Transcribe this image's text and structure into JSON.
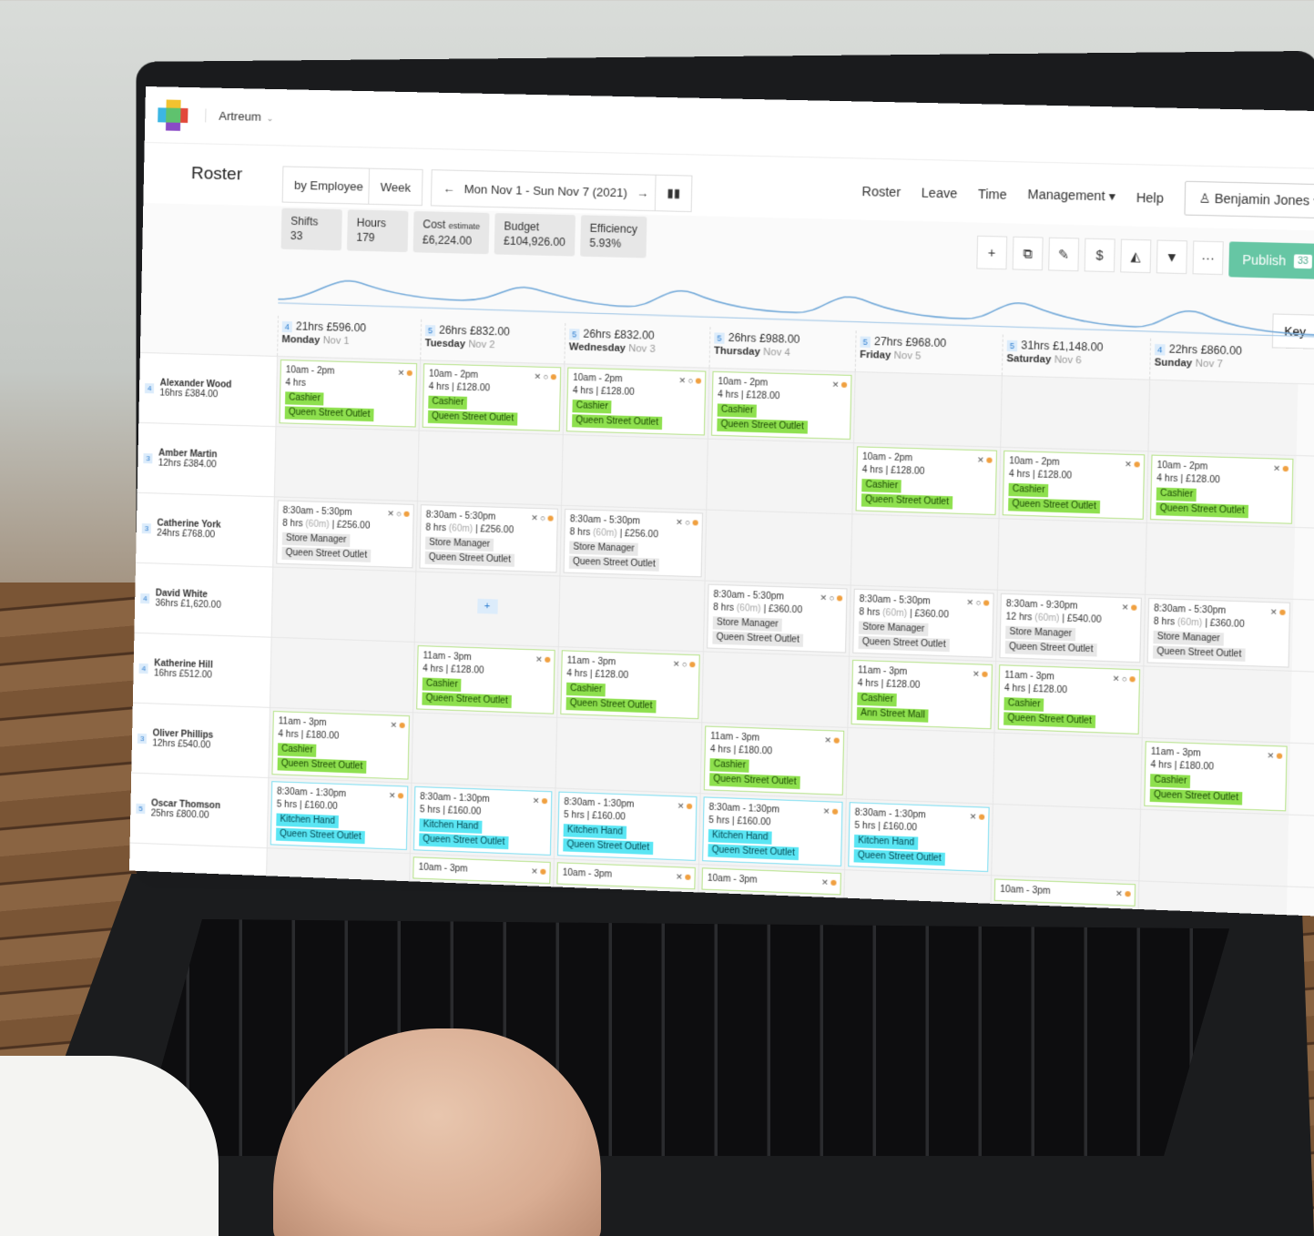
{
  "app": {
    "org": "Artreum"
  },
  "header": {
    "title": "Roster",
    "view_by": "by Employee",
    "period": "Week",
    "range": "Mon Nov 1 - Sun Nov 7 (2021)",
    "nav": [
      "Roster",
      "Leave",
      "Time",
      "Management",
      "Help"
    ],
    "user": "Benjamin Jones"
  },
  "stats": [
    {
      "label": "Shifts",
      "value": "33"
    },
    {
      "label": "Hours",
      "value": "179"
    },
    {
      "label": "Cost",
      "sub": "estimate",
      "value": "£6,224.00"
    },
    {
      "label": "Budget",
      "value": "£104,926.00"
    },
    {
      "label": "Efficiency",
      "value": "5.93%"
    }
  ],
  "toolbar": {
    "publish": "Publish",
    "publish_count": "33",
    "key": "Key",
    "more": "···"
  },
  "days": [
    {
      "count": "4",
      "hours": "21hrs",
      "cost": "£596.00",
      "day": "Monday",
      "date": "Nov 1"
    },
    {
      "count": "5",
      "hours": "26hrs",
      "cost": "£832.00",
      "day": "Tuesday",
      "date": "Nov 2"
    },
    {
      "count": "5",
      "hours": "26hrs",
      "cost": "£832.00",
      "day": "Wednesday",
      "date": "Nov 3"
    },
    {
      "count": "5",
      "hours": "26hrs",
      "cost": "£988.00",
      "day": "Thursday",
      "date": "Nov 4"
    },
    {
      "count": "5",
      "hours": "27hrs",
      "cost": "£968.00",
      "day": "Friday",
      "date": "Nov 5"
    },
    {
      "count": "5",
      "hours": "31hrs",
      "cost": "£1,148.00",
      "day": "Saturday",
      "date": "Nov 6"
    },
    {
      "count": "4",
      "hours": "22hrs",
      "cost": "£860.00",
      "day": "Sunday",
      "date": "Nov 7"
    }
  ],
  "employees": [
    {
      "name": "Alexander Wood",
      "count": "4",
      "hours": "16hrs",
      "cost": "£384.00"
    },
    {
      "name": "Amber Martin",
      "count": "3",
      "hours": "12hrs",
      "cost": "£384.00"
    },
    {
      "name": "Catherine York",
      "count": "3",
      "hours": "24hrs",
      "cost": "£768.00"
    },
    {
      "name": "David White",
      "count": "4",
      "hours": "36hrs",
      "cost": "£1,620.00"
    },
    {
      "name": "Katherine Hill",
      "count": "4",
      "hours": "16hrs",
      "cost": "£512.00"
    },
    {
      "name": "Oliver Phillips",
      "count": "3",
      "hours": "12hrs",
      "cost": "£540.00"
    },
    {
      "name": "Oscar Thomson",
      "count": "5",
      "hours": "25hrs",
      "cost": "£800.00"
    }
  ],
  "shifts": {
    "cashier_qs_2": {
      "time": "10am - 2pm",
      "detail": "4 hrs | £128.00",
      "role": "Cashier",
      "location": "Queen Street Outlet"
    },
    "cashier_qs_mon": {
      "time": "10am - 2pm",
      "detail": "4 hrs",
      "role": "Cashier",
      "location": "Queen Street Outlet"
    },
    "mgr_256": {
      "time": "8:30am - 5:30pm",
      "hrs": "8 hrs",
      "break": "(60m)",
      "cost": "| £256.00",
      "role": "Store Manager",
      "location": "Queen Street Outlet"
    },
    "mgr_360": {
      "time": "8:30am - 5:30pm",
      "hrs": "8 hrs",
      "break": "(60m)",
      "cost": "| £360.00",
      "role": "Store Manager",
      "location": "Queen Street Outlet"
    },
    "mgr_540": {
      "time": "8:30am - 9:30pm",
      "hrs": "12 hrs",
      "break": "(60m)",
      "cost": "| £540.00",
      "role": "Store Manager",
      "location": "Queen Street Outlet"
    },
    "kh_11": {
      "time": "11am - 3pm",
      "detail": "4 hrs | £128.00",
      "role": "Cashier",
      "location": "Queen Street Outlet"
    },
    "kh_ann": {
      "time": "11am - 3pm",
      "detail": "4 hrs | £128.00",
      "role": "Cashier",
      "location": "Ann Street Mall"
    },
    "op_180": {
      "time": "11am - 3pm",
      "detail": "4 hrs | £180.00",
      "role": "Cashier",
      "location": "Queen Street Outlet"
    },
    "kitchen": {
      "time": "8:30am - 1:30pm",
      "detail": "5 hrs | £160.00",
      "role": "Kitchen Hand",
      "location": "Queen Street Outlet"
    },
    "next_10": {
      "time": "10am - 3pm"
    }
  }
}
